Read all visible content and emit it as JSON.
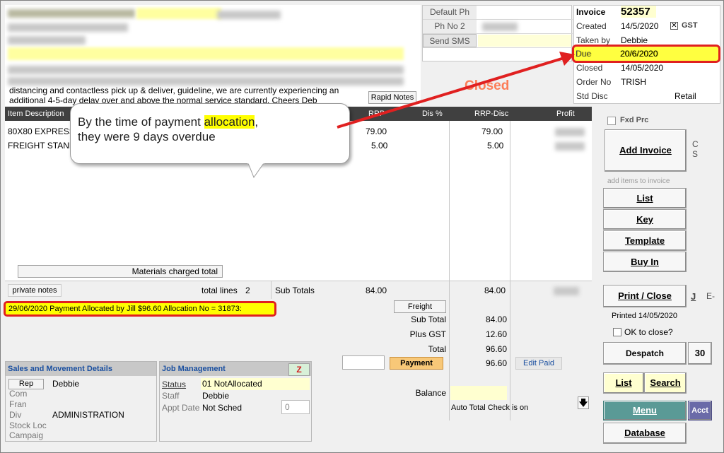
{
  "customer": {
    "notes_visible": "distancing and contactless pick up & deliver, guideline, we are currently experiencing an",
    "notes_visible2": "additional 4-5-day delay over and above the normal service standard. Cheers Deb",
    "rapid_notes_label": "Rapid Notes"
  },
  "phones": {
    "default_ph_label": "Default Ph",
    "ph_no2_label": "Ph No 2",
    "send_sms_label": "Send SMS"
  },
  "invoice": {
    "invoice_label": "Invoice",
    "invoice_no": "52357",
    "created_label": "Created",
    "created": "14/5/2020",
    "gst_label": "GST",
    "taken_by_label": "Taken by",
    "taken_by": "Debbie",
    "due_label": "Due",
    "due": "20/6/2020",
    "closed_label": "Closed",
    "closed": "14/05/2020",
    "order_no_label": "Order No",
    "order_no": "TRISH",
    "std_disc_label": "Std Disc",
    "std_disc": "Retail"
  },
  "status_stamp": "Closed",
  "table": {
    "headers": [
      "Item Description",
      "RRP",
      "Dis %",
      "RRP-Disc",
      "Profit"
    ],
    "rows": [
      {
        "desc": "80X80 EXPRESS",
        "rrp": "79.00",
        "rrp_disc": "79.00"
      },
      {
        "desc": "FREIGHT STANDARD",
        "rrp": "5.00",
        "rrp_disc": "5.00"
      }
    ],
    "materials_btn": "Materials charged total"
  },
  "totals": {
    "private_notes": "private notes",
    "total_lines_label": "total lines",
    "total_lines": "2",
    "subtotals_label": "Sub Totals",
    "subtotal_rrp": "84.00",
    "subtotal_disc": "84.00"
  },
  "allocation_text": "29/06/2020 Payment Allocated by Jill $96.60 Allocation No = 31873:",
  "summary": {
    "freight_btn": "Freight",
    "sub_total_label": "Sub Total",
    "sub_total": "84.00",
    "plus_gst_label": "Plus GST",
    "plus_gst": "12.60",
    "total_label": "Total",
    "total": "96.60",
    "payment_btn": "Payment",
    "payment": "96.60",
    "edit_paid_btn": "Edit Paid",
    "balance_label": "Balance",
    "auto_total": "Auto Total Check is on"
  },
  "sales_panel": {
    "title": "Sales and Movement Details",
    "rep_btn": "Rep",
    "rep": "Debbie",
    "com": "Com",
    "fran": "Fran",
    "div": "Div",
    "div_val": "ADMINISTRATION",
    "stock_loc": "Stock Loc",
    "campaign": "Campaig"
  },
  "job_panel": {
    "title": "Job Management",
    "z_btn": "Z",
    "status_label": "Status",
    "status": "01 NotAllocated",
    "staff_label": "Staff",
    "staff": "Debbie",
    "appt_label": "Appt Date",
    "appt": "Not Sched",
    "appt_num": "0"
  },
  "sidebar": {
    "fxd_prc": "Fxd Prc",
    "add_invoice": "Add Invoice",
    "cs": "C\nS",
    "add_items_hint": "add items to invoice",
    "list": "List",
    "key": "Key",
    "template": "Template",
    "buy_in": "Buy In",
    "print_close": "Print / Close",
    "j": "J",
    "e": "E-",
    "printed": "Printed 14/05/2020",
    "ok_to_close": "OK to close?",
    "despatch": "Despatch",
    "despatch_num": "30",
    "list2": "List",
    "search": "Search",
    "menu": "Menu",
    "acct": "Acct",
    "database": "Database"
  },
  "callout": {
    "before": "By the time of payment ",
    "highlight": "allocation",
    "after": ",",
    "line2": "they were 9 days overdue"
  },
  "colors": {
    "accent_red": "#e02020",
    "highlight_yellow": "#ffff00",
    "header_dark": "#404040",
    "panel_blue": "#1a4fa0",
    "menu_teal": "#5a9a96"
  }
}
